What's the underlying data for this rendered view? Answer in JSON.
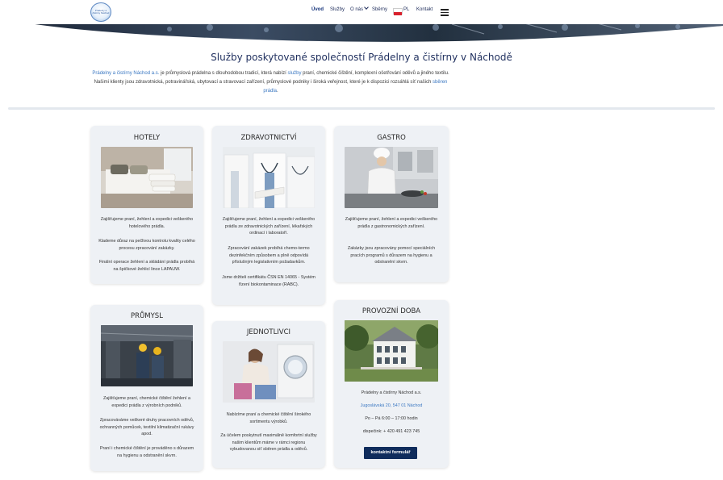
{
  "header": {
    "logo_text": "Prádelny a čistírny Náchod",
    "nav": [
      {
        "label": "Úvod",
        "active": true
      },
      {
        "label": "Služby"
      },
      {
        "label": "O nás"
      },
      {
        "label": "Sběrny"
      },
      {
        "label": "PL"
      },
      {
        "label": "Kontakt"
      }
    ]
  },
  "intro": {
    "title": "Služby poskytované společností Prádelny a čistírny v Náchodě",
    "link1": "Prádelny a čistírny Náchod a.s.",
    "text1": " je průmyslová prádelna s dlouhodobou tradicí, která nabízí ",
    "link2": "služby",
    "text2": " praní, chemické čištění, komplexní ošetřování oděvů a jiného textilu. Našimi klienty jsou zdravotnická, potravinářská, ubytovací a stravovací zařízení, průmyslové podniky i široká veřejnost, které je k dispozici rozsáhlá síť našich ",
    "link3": "sběren prádla",
    "text3": "."
  },
  "cards": {
    "hotely": {
      "title": "HOTELY",
      "p1": "Zajišťujeme praní, žehlení a expedici veškerého hotelového prádla.",
      "p2": "Klademe důraz na pečlivou kontrolu kvality celého procesu zpracování zakázky.",
      "p3": "Finální operace žehlení a skládání prádla probíhá na špičkové žehlicí lince LAPAUW."
    },
    "zdravotnictvi": {
      "title": "ZDRAVOTNICTVÍ",
      "p1": "Zajišťujeme praní, žehlení a expedici veškerého prádla ze zdravotnických zařízení, lékařských ordinací i laboratoří.",
      "p2": "Zpracování zakázek probíhá chemo-termo dezinfekčním způsobem a plně odpovídá příslušným legislativním požadavkům.",
      "p3": "Jsme držiteli certifikátu ČSN EN 14065 - Systém řízení biokontaminace (RABC)."
    },
    "gastro": {
      "title": "GASTRO",
      "p1": "Zajišťujeme praní, žehlení a expedici veškerého prádla z gastronomických zařízení.",
      "p2": "Zakázky jsou zpracovány pomocí speciálních pracích programů s důrazem na hygienu a odstranění skvrn."
    },
    "prumysl": {
      "title": "PRŮMYSL",
      "p1": "Zajišťujeme praní, chemické čištění žehlení a expedici prádla z výrobních podniků.",
      "p2": "Zpracováváme veškeré druhy pracovních oděvů, ochranných pomůcek, textilní klimatizační rukávy apod.",
      "p3": "Praní i chemické čištění je prováděno s důrazem na hygienu a odstranění skvrn."
    },
    "jednotlivci": {
      "title": "JEDNOTLIVCI",
      "p1": "Nabízíme praní a chemické čištění širokého sortimentu výrobků.",
      "p2": "Za účelem poskytnutí maximálně komfortní služby našim klientům máme v rámci regionu vybudovanou síť sběren prádla a oděvů."
    },
    "provozni": {
      "title": "PROVOZNÍ DOBA",
      "company": "Prádelny a čistírny Náchod a.s.",
      "address": "Jugoslávská 20, 547 01 Náchod",
      "hours": "Po – Pá  6:00 – 17:00 hodin",
      "phone": "dispečink: + 420 491 423 745",
      "button": "kontaktní formulář"
    }
  },
  "colors": {
    "accent_link": "#3b78c2",
    "nav_text": "#1d2b5a",
    "button_bg": "#0f2c5c",
    "card_bg": "#eef1f5"
  }
}
